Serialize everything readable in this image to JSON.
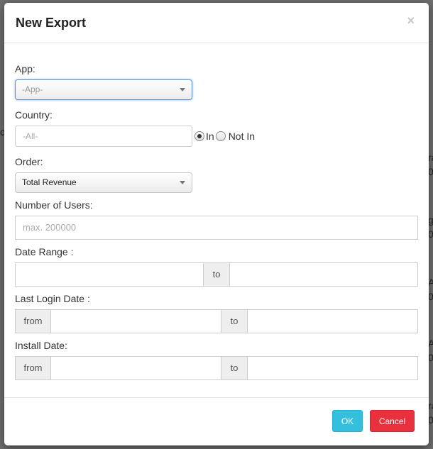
{
  "background": {
    "fragments": [
      "c",
      "ra",
      "0",
      "g",
      "0",
      "A",
      "0",
      "A",
      "0",
      "ra",
      "0",
      "ra"
    ]
  },
  "modal": {
    "title": "New Export",
    "close_glyph": "×"
  },
  "form": {
    "app": {
      "label": "App:",
      "selected": "-App-"
    },
    "country": {
      "label": "Country:",
      "placeholder": "-All-",
      "radio_in": "In",
      "radio_not_in": "Not In",
      "selected_option": "In"
    },
    "order": {
      "label": "Order:",
      "selected": "Total Revenue"
    },
    "number_of_users": {
      "label": "Number of Users:",
      "placeholder": "max. 200000"
    },
    "date_range": {
      "label": "Date Range :",
      "to": "to",
      "start": "",
      "end": ""
    },
    "last_login_date": {
      "label": "Last Login Date :",
      "from": "from",
      "to": "to"
    },
    "install_date": {
      "label": "Install Date:",
      "from": "from",
      "to": "to"
    }
  },
  "footer": {
    "ok_label": "OK",
    "cancel_label": "Cancel"
  },
  "colors": {
    "ok": "#35bfde",
    "cancel": "#e9313e",
    "overlay": "#6f6f6f"
  }
}
